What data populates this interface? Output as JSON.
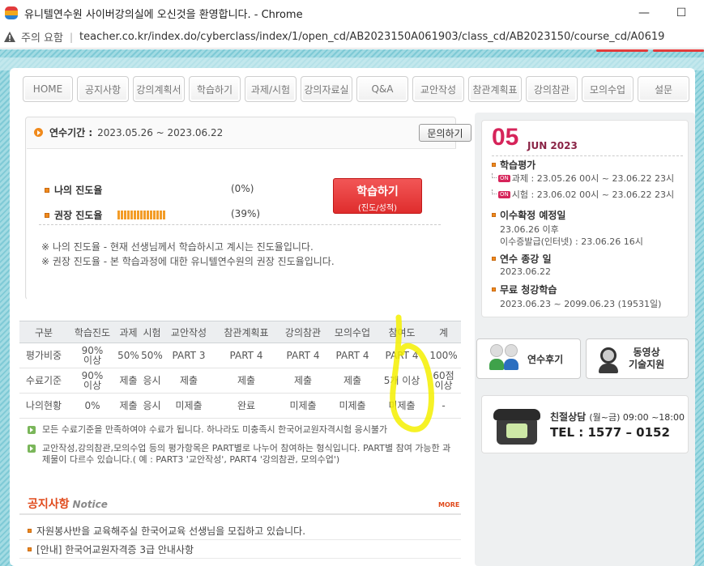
{
  "browser": {
    "title": "유니텔연수원 사이버강의실에 오신것을 환영합니다. - Chrome",
    "security_label": "주의 요함",
    "url": "teacher.co.kr/index.do/cyberclass/index/1/open_cd/AB2023150A061903/class_cd/AB2023150/course_cd/A0619",
    "minimize": "—",
    "maximize": "☐"
  },
  "nav": {
    "items": [
      "HOME",
      "공지사항",
      "강의계획서",
      "학습하기",
      "과제/시험",
      "강의자료실",
      "Q&A",
      "교안작성",
      "참관계획표",
      "강의참관",
      "모의수업",
      "설문"
    ]
  },
  "period": {
    "label": "연수기간 :",
    "value": "2023.05.26 ~ 2023.06.22",
    "inquiry_button": "문의하기"
  },
  "progress": {
    "my_label": "나의 진도율",
    "my_pct": "(0%)",
    "my_value": 0,
    "rec_label": "권장 진도율",
    "rec_pct": "(39%)",
    "rec_value": 39,
    "study_button": "학습하기",
    "study_sub": "(진도/성적)",
    "note1": "※ 나의 진도율 - 현재 선생님께서 학습하시고 계시는 진도율입니다.",
    "note2": "※ 권장 진도율 - 본 학습과정에 대한 유니텔연수원의 권장 진도율입니다."
  },
  "table": {
    "headers": [
      "구분",
      "학습진도",
      "과제",
      "시험",
      "교안작성",
      "참관계획표",
      "강의참관",
      "모의수업",
      "참여도",
      "계"
    ],
    "rows": [
      [
        "평가비중",
        "90%\n이상",
        "50%",
        "50%",
        "PART 3",
        "PART 4",
        "PART 4",
        "PART 4",
        "PART 4",
        "100%"
      ],
      [
        "수료기준",
        "90%\n이상",
        "제출",
        "응시",
        "제출",
        "제출",
        "제출",
        "제출",
        "5개 이상",
        "60점\n이상"
      ],
      [
        "나의현황",
        "0%",
        "제출",
        "응시",
        "미제출",
        "완료",
        "미제출",
        "미제출",
        "미제출",
        "-"
      ]
    ]
  },
  "info": {
    "line1": "모든 수료기준을 만족하여야 수료가 됩니다. 하나라도 미충족시 한국어교원자격시험 응시불가",
    "line2": "교안작성,강의참관,모의수업 등의 평가항목은 PART별로 나누어 참여하는 형식입니다. PART별 참여 가능한 과제물이 다르수 있습니다.( 예 : PART3 '교안작성', PART4 '강의참관, 모의수업')"
  },
  "notice": {
    "title": "공지사항",
    "subtitle": "Notice",
    "more": "MORE",
    "items": [
      "자원봉사반을 교육해주실 한국어교육 선생님을 모집하고 있습니다.",
      "[안내] 한국어교원자격증 3급 안내사항"
    ]
  },
  "calendar": {
    "day": "05",
    "month": "JUN 2023",
    "badge": "ON",
    "eval_title": "학습평가",
    "eval_assign": "과제 : 23.05.26 00시 ~ 23.06.22 23시",
    "eval_exam": "시험 : 23.06.02 00시 ~ 23.06.22 23시",
    "confirm_title": "이수확정 예정일",
    "confirm_line1": "23.06.26 이후",
    "confirm_line2": "이수증발급(인터넷) : 23.06.26 16시",
    "end_title": "연수 종강 일",
    "end_value": "2023.06.22",
    "free_title": "무료 청강학습",
    "free_value": "2023.06.23 ~ 2099.06.23 (19531일)"
  },
  "cards": {
    "review": "연수후기",
    "video_support_1": "동영상",
    "video_support_2": "기술지원"
  },
  "contact": {
    "title": "친절상담",
    "hours": "(월~금) 09:00 ~18:00",
    "phone": "TEL : 1577 – 0152"
  },
  "colors": {
    "accent_red": "#e04a1c",
    "study_button": "#df2d2d",
    "cal_day": "#d6245a",
    "progress_orange": "#f39c27",
    "highlight": "#f4f000"
  }
}
